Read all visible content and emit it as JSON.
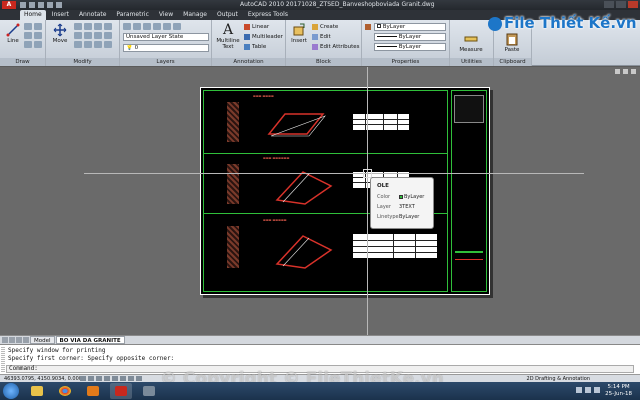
{
  "window": {
    "app_logo": "A",
    "title": "AutoCAD 2010    20171028_ZTSED_Banveshopboviada Granit.dwg"
  },
  "ribbon_tabs": [
    "Home",
    "Insert",
    "Annotate",
    "Parametric",
    "View",
    "Manage",
    "Output",
    "Express Tools"
  ],
  "ribbon": {
    "draw": {
      "title": "Draw",
      "line": "Line"
    },
    "modify": {
      "title": "Modify",
      "move": "Move"
    },
    "layers": {
      "title": "Layers",
      "layer_state": "Unsaved Layer State",
      "layer_value": "0"
    },
    "annotation": {
      "title": "Annotation",
      "text": "Multiline Text",
      "linear": "Linear",
      "multileader": "Multileader",
      "table": "Table"
    },
    "block": {
      "title": "Block",
      "insert": "Insert",
      "create": "Create",
      "edit": "Edit",
      "edit_attributes": "Edit Attributes"
    },
    "properties": {
      "title": "Properties",
      "color": "ByLayer",
      "linetype": "ByLayer",
      "lineweight": "ByLayer"
    },
    "utilities": {
      "title": "Utilities",
      "measure": "Measure"
    },
    "clipboard": {
      "title": "Clipboard",
      "paste": "Paste"
    }
  },
  "watermark_logo": "File Thiết Kế.vn",
  "tooltip": {
    "object": "OLE",
    "rows": [
      {
        "key": "Color",
        "value": "ByLayer"
      },
      {
        "key": "Layer",
        "value": "3TEXT"
      },
      {
        "key": "Linetype",
        "value": "ByLayer"
      }
    ]
  },
  "layout_tabs": [
    "Model",
    "BO VIA DA GRANITE"
  ],
  "command": {
    "history": [
      "Specify window for printing",
      "Specify first corner: Specify opposite corner:"
    ],
    "prompt": "Command:"
  },
  "status": {
    "coords": "46393.0795, 4150.9034, 0.0000",
    "workspace": "2D Drafting & Annotation"
  },
  "watermark_copyright": "© Copyright © FileThietKe.vn",
  "taskbar": {
    "time": "5:14 PM",
    "date": "25-Jun-18"
  },
  "colors": {
    "layer_green": "#2fbf3a",
    "section_red": "#d8322a",
    "brand_blue": "#1d76c8"
  }
}
